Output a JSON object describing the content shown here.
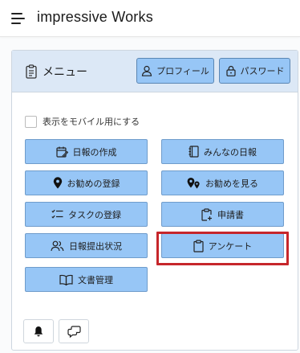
{
  "app": {
    "title": "impressive Works"
  },
  "menu": {
    "title": "メニュー",
    "profile_label": "プロフィール",
    "password_label": "パスワード",
    "mobile_toggle_label": "表示をモバイル用にする",
    "buttons": [
      {
        "label": "日報の作成",
        "icon": "calendar-edit-icon"
      },
      {
        "label": "みんなの日報",
        "icon": "notebook-icon"
      },
      {
        "label": "お勧めの登録",
        "icon": "map-pin-icon"
      },
      {
        "label": "お勧めを見る",
        "icon": "map-pins-icon"
      },
      {
        "label": "タスクの登録",
        "icon": "checklist-icon"
      },
      {
        "label": "申請書",
        "icon": "clipboard-add-icon"
      },
      {
        "label": "日報提出状況",
        "icon": "users-icon"
      },
      {
        "label": "アンケート",
        "icon": "clipboard-icon"
      },
      {
        "label": "文書管理",
        "icon": "book-open-icon"
      }
    ],
    "highlighted": "アンケート"
  },
  "footer": {
    "icons": [
      "bell-icon",
      "chat-icon"
    ]
  },
  "colors": {
    "button_bg": "#97c6f6",
    "header_bg": "#dce8f6",
    "highlight": "#c6262b"
  }
}
